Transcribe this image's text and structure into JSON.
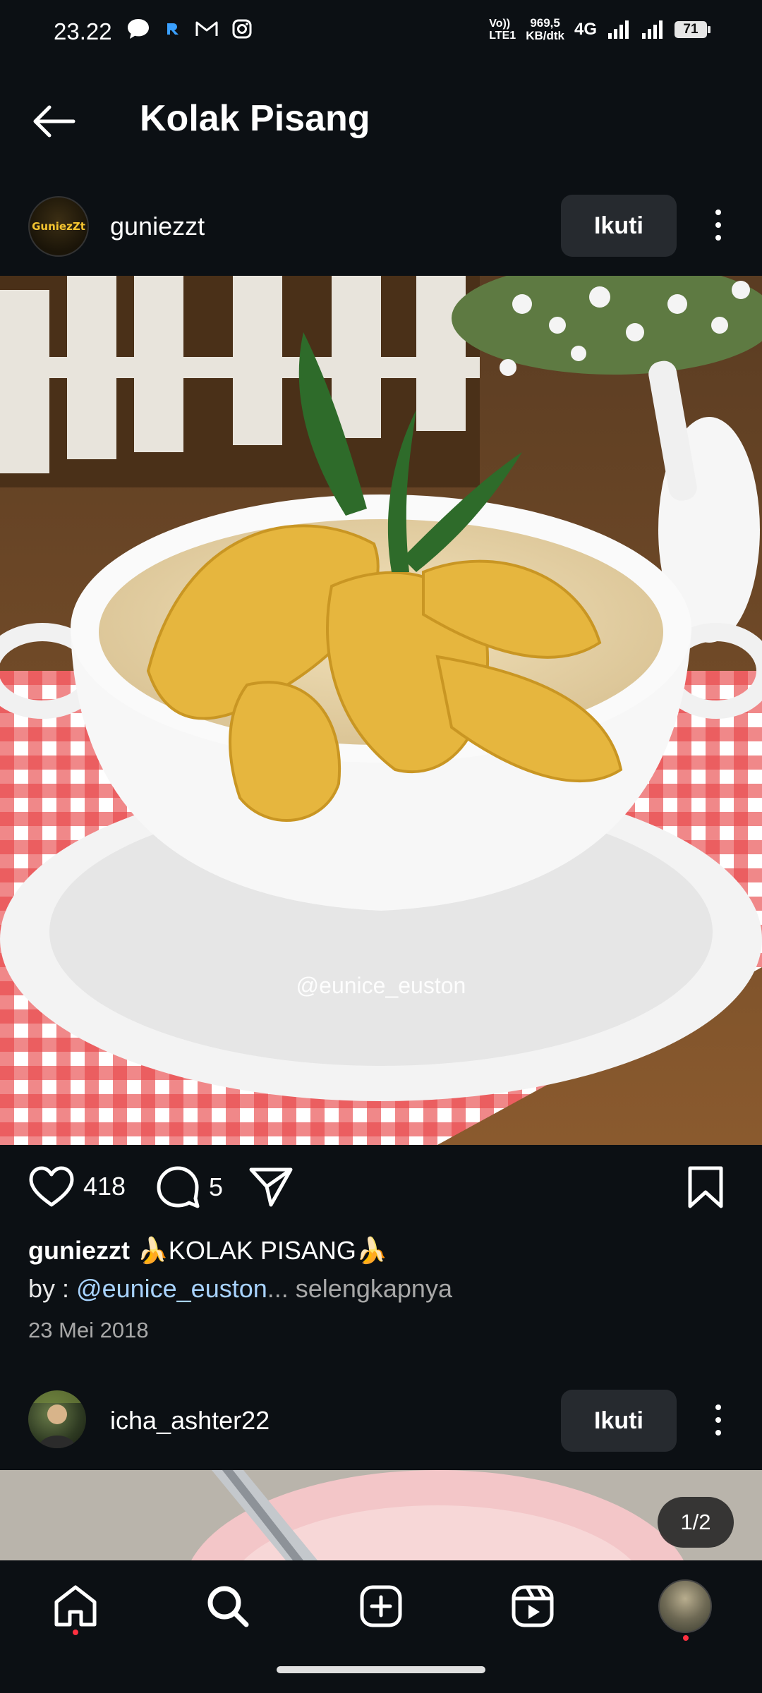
{
  "status_bar": {
    "time": "23.22",
    "lte_label": "Vo)) LTE1",
    "speed_value": "969,5",
    "speed_unit": "KB/dtk",
    "network": "4G",
    "battery": "71",
    "icons_left": [
      "chat-bubble-icon",
      "r-app-icon",
      "gmail-icon",
      "instagram-icon"
    ],
    "icons_right": [
      "signal-icon",
      "signal-icon"
    ]
  },
  "header": {
    "title": "Kolak Pisang"
  },
  "post1": {
    "username": "guniezzt",
    "avatar_text": "GuniezZt",
    "follow_label": "Ikuti",
    "watermark": "@eunice_euston",
    "likes": "418",
    "comments": "5",
    "caption_user": "guniezzt",
    "caption_text": " 🍌KOLAK PISANG🍌",
    "caption_by": "by : ",
    "caption_mention": "@eunice_euston",
    "caption_more": "... selengkapnya",
    "date": "23 Mei 2018"
  },
  "post2": {
    "username": "icha_ashter22",
    "follow_label": "Ikuti",
    "page_indicator": "1/2"
  },
  "nav": {
    "items": [
      "home-icon",
      "search-icon",
      "create-icon",
      "reels-icon",
      "profile-avatar"
    ]
  },
  "colors": {
    "background": "#0c1014",
    "button_bg": "#262a2f",
    "mention": "#a8d3ff",
    "muted": "#a8a8a8",
    "notification": "#ff3040"
  }
}
